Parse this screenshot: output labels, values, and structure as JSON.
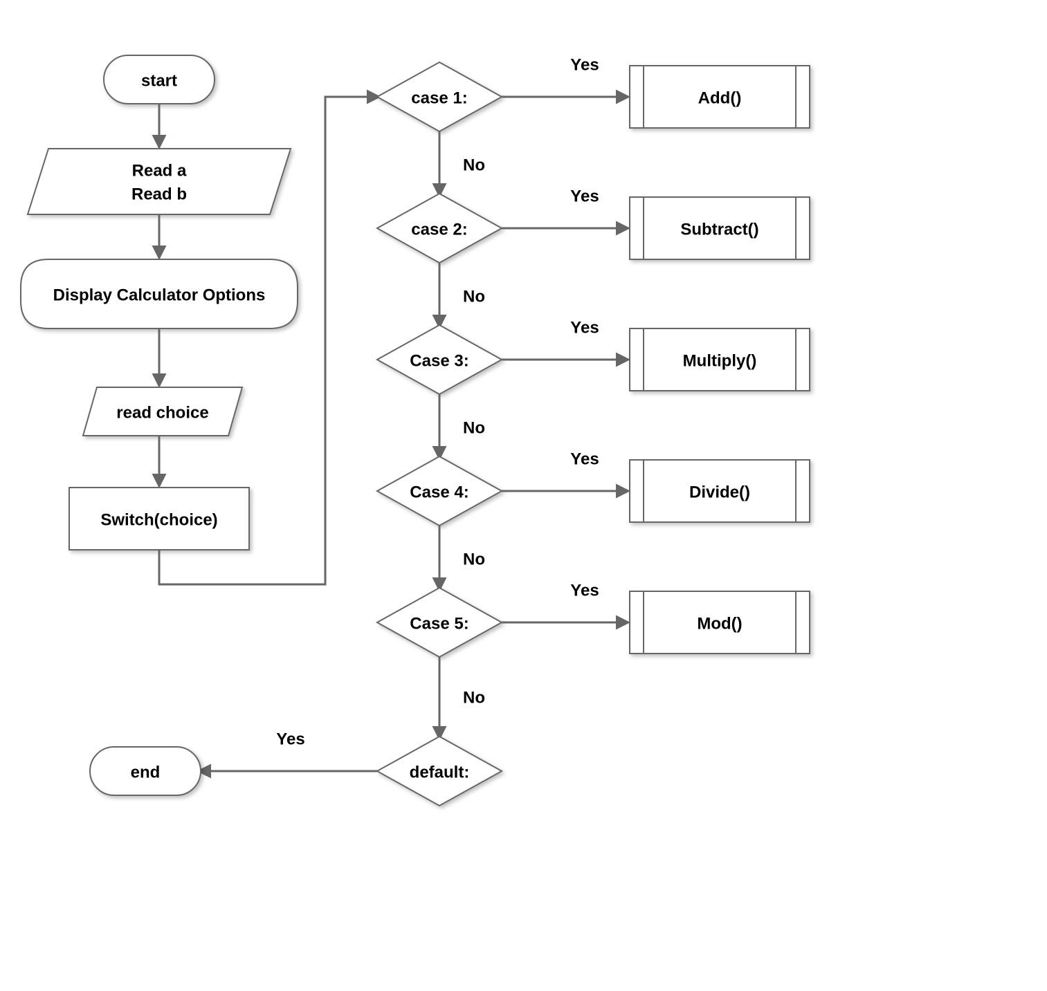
{
  "start": "start",
  "read_ab_line1": "Read a",
  "read_ab_line2": "Read b",
  "display_options": "Display Calculator Options",
  "read_choice": "read choice",
  "switch_choice": "Switch(choice)",
  "case1": "case 1:",
  "case2": "case 2:",
  "case3": "Case 3:",
  "case4": "Case 4:",
  "case5": "Case 5:",
  "default": "default:",
  "add": "Add()",
  "subtract": "Subtract()",
  "multiply": "Multiply()",
  "divide": "Divide()",
  "mod": "Mod()",
  "end": "end",
  "yes": "Yes",
  "no": "No"
}
